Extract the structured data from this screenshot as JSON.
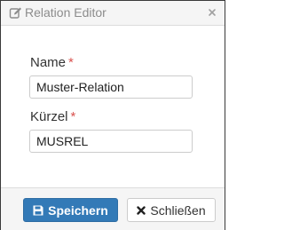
{
  "dialog": {
    "title": "Relation Editor",
    "title_icon": "edit-icon",
    "close_icon": "close-icon"
  },
  "form": {
    "name": {
      "label": "Name",
      "required_marker": "*",
      "value": "Muster-Relation"
    },
    "kuerzel": {
      "label": "Kürzel",
      "required_marker": "*",
      "value": "MUSREL"
    }
  },
  "footer": {
    "save_label": "Speichern",
    "save_icon": "save-icon",
    "close_label": "Schließen",
    "close_icon": "close-icon"
  },
  "colors": {
    "primary": "#337ab7",
    "required": "#d9534f"
  }
}
